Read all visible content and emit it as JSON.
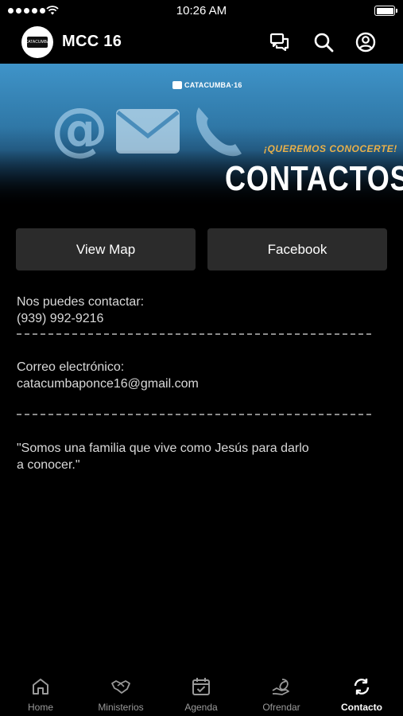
{
  "status_bar": {
    "time": "10:26 AM"
  },
  "app_bar": {
    "title": "MCC 16",
    "logo_text": "CATACUMBA"
  },
  "hero": {
    "brand": "CATACUMBA·16",
    "subtitle": "¡QUEREMOS CONOCERTE!",
    "title": "CONTACTOS"
  },
  "buttons": {
    "map": "View Map",
    "facebook": "Facebook"
  },
  "contact": {
    "phone_label": "Nos puedes contactar:",
    "phone": "(939) 992-9216",
    "email_label": "Correo electrónico:",
    "email": "catacumbaponce16@gmail.com",
    "quote_line1": "\"Somos una familia que vive como Jesús para darlo",
    "quote_line2": "a conocer.\""
  },
  "tabs": [
    {
      "label": "Home",
      "icon": "home-icon"
    },
    {
      "label": "Ministerios",
      "icon": "handshake-icon"
    },
    {
      "label": "Agenda",
      "icon": "calendar-check-icon"
    },
    {
      "label": "Ofrendar",
      "icon": "hand-leaf-icon"
    },
    {
      "label": "Contacto",
      "icon": "refresh-icon"
    }
  ],
  "active_tab": "Contacto",
  "colors": {
    "background": "#000000",
    "button": "#2b2b2b",
    "accent": "#e8b04a"
  }
}
